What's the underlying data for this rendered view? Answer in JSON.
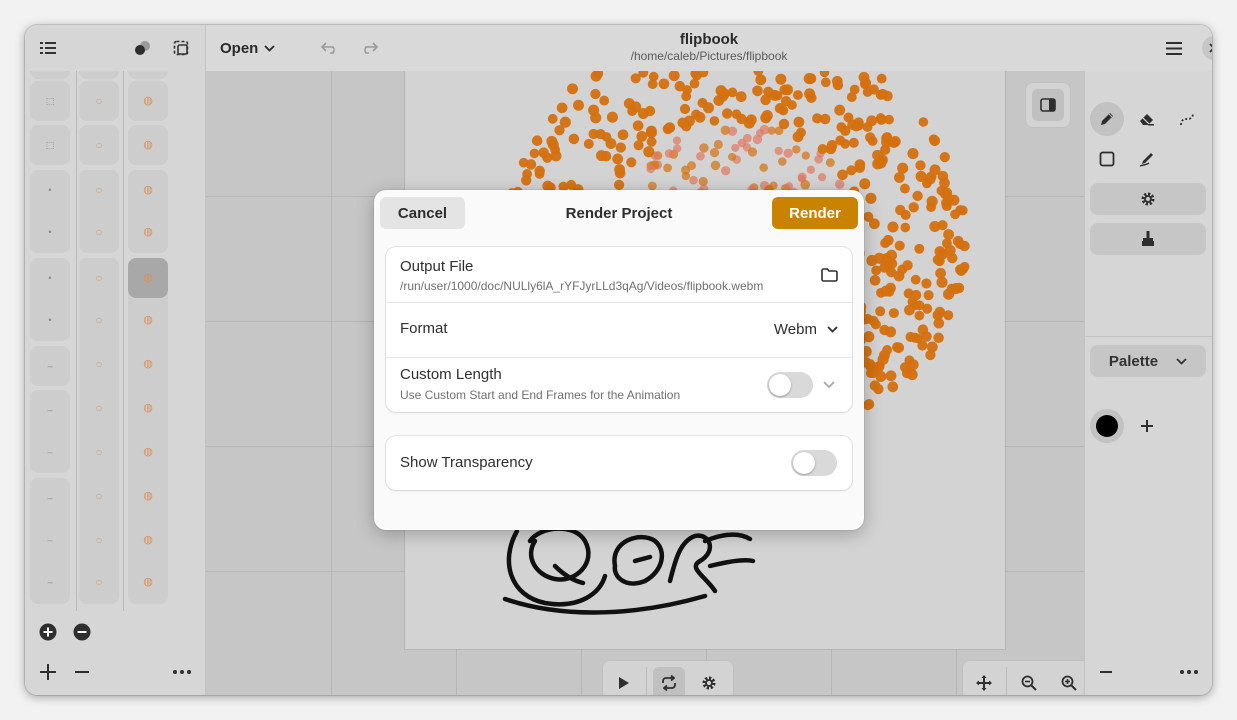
{
  "header": {
    "open_label": "Open",
    "title": "flipbook",
    "path": "/home/caleb/Pictures/flipbook"
  },
  "dialog": {
    "cancel_label": "Cancel",
    "title": "Render Project",
    "render_label": "Render",
    "output_file_title": "Output File",
    "output_file_path": "/run/user/1000/doc/NULly6lA_rYFJyrLLd3qAg/Videos/flipbook.webm",
    "format_title": "Format",
    "format_value": "Webm",
    "custom_length_title": "Custom Length",
    "custom_length_subtitle": "Use Custom Start and End Frames for the Animation",
    "custom_length_enabled": false,
    "show_transparency_title": "Show Transparency",
    "show_transparency_enabled": false
  },
  "tools": {
    "palette_label": "Palette",
    "current_color": "#000000"
  },
  "colors": {
    "accent": "#c98300",
    "stroke_orange": "#d4700f",
    "stroke_salmon": "#e07860"
  }
}
